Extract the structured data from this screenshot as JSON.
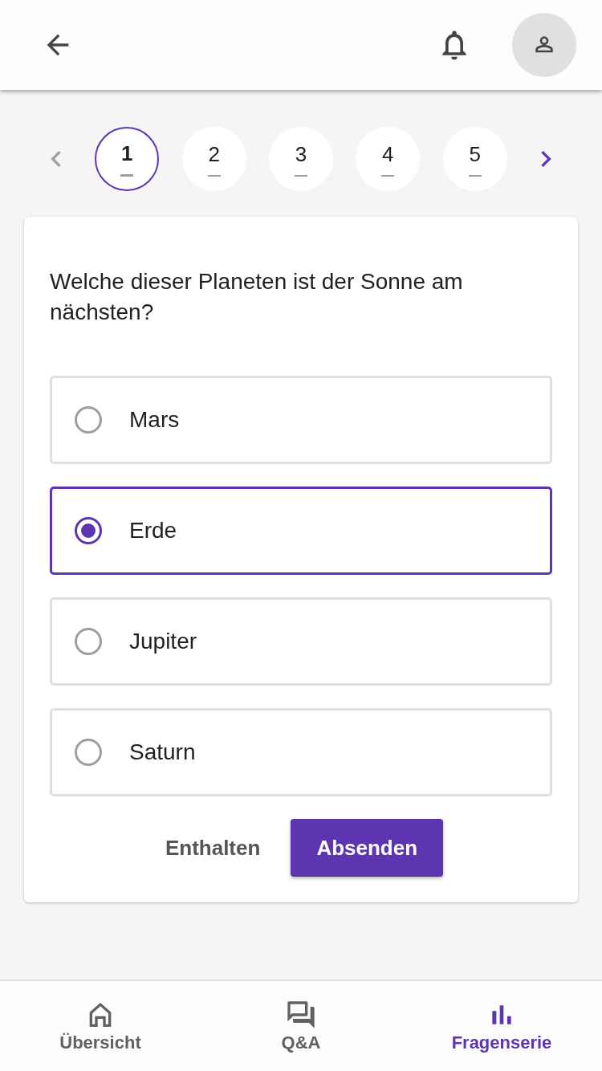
{
  "pager": {
    "pages": [
      {
        "label": "1",
        "selected": true
      },
      {
        "label": "2",
        "selected": false
      },
      {
        "label": "3",
        "selected": false
      },
      {
        "label": "4",
        "selected": false
      },
      {
        "label": "5",
        "selected": false
      }
    ],
    "prev_disabled": true
  },
  "question": {
    "text": "Welche dieser Planeten ist der Sonne am nächsten?",
    "options": [
      {
        "label": "Mars",
        "selected": false
      },
      {
        "label": "Erde",
        "selected": true
      },
      {
        "label": "Jupiter",
        "selected": false
      },
      {
        "label": "Saturn",
        "selected": false
      }
    ],
    "abstain_button": "Enthalten",
    "submit_button": "Absenden"
  },
  "bottom_nav": [
    {
      "label": "Übersicht",
      "kind": "home",
      "selected": false
    },
    {
      "label": "Q&A",
      "kind": "chat",
      "selected": false
    },
    {
      "label": "Fragenserie",
      "kind": "chart",
      "selected": true
    }
  ]
}
